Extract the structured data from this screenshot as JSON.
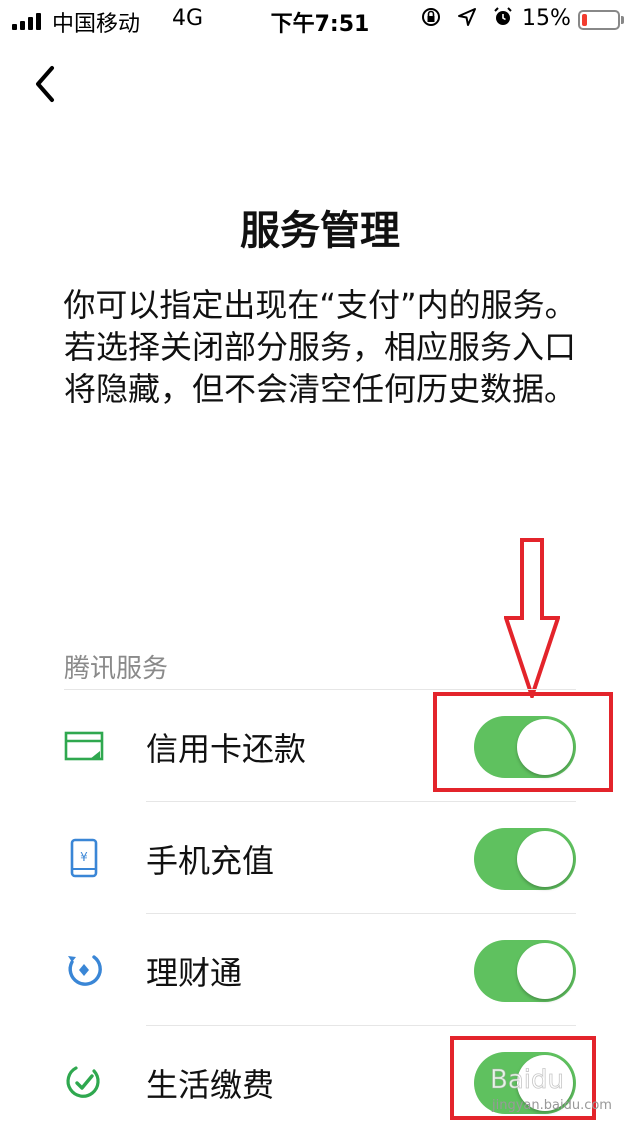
{
  "status_bar": {
    "carrier": "中国移动",
    "network": "4G",
    "time": "下午7:51",
    "battery_percent": "15%",
    "battery_level": 0.15,
    "icons": [
      "orientation-lock-icon",
      "location-icon",
      "alarm-icon"
    ]
  },
  "nav": {
    "back_icon": "chevron-left-icon"
  },
  "page": {
    "title": "服务管理",
    "description": "你可以指定出现在“支付”内的服务。若选择关闭部分服务，相应服务入口将隐藏，但不会清空任何历史数据。"
  },
  "section": {
    "header": "腾讯服务",
    "items": [
      {
        "label": "信用卡还款",
        "icon": "credit-card-icon",
        "enabled": true
      },
      {
        "label": "手机充值",
        "icon": "phone-topup-icon",
        "enabled": true
      },
      {
        "label": "理财通",
        "icon": "wealth-icon",
        "enabled": true
      },
      {
        "label": "生活缴费",
        "icon": "utility-payment-icon",
        "enabled": true
      }
    ]
  },
  "colors": {
    "toggle_on": "#5fc15f",
    "annotation_red": "#e3242b",
    "battery_low": "#f23c2f"
  },
  "watermark": {
    "text": "Baidu 经验",
    "url": "jingyan.baidu.com"
  }
}
